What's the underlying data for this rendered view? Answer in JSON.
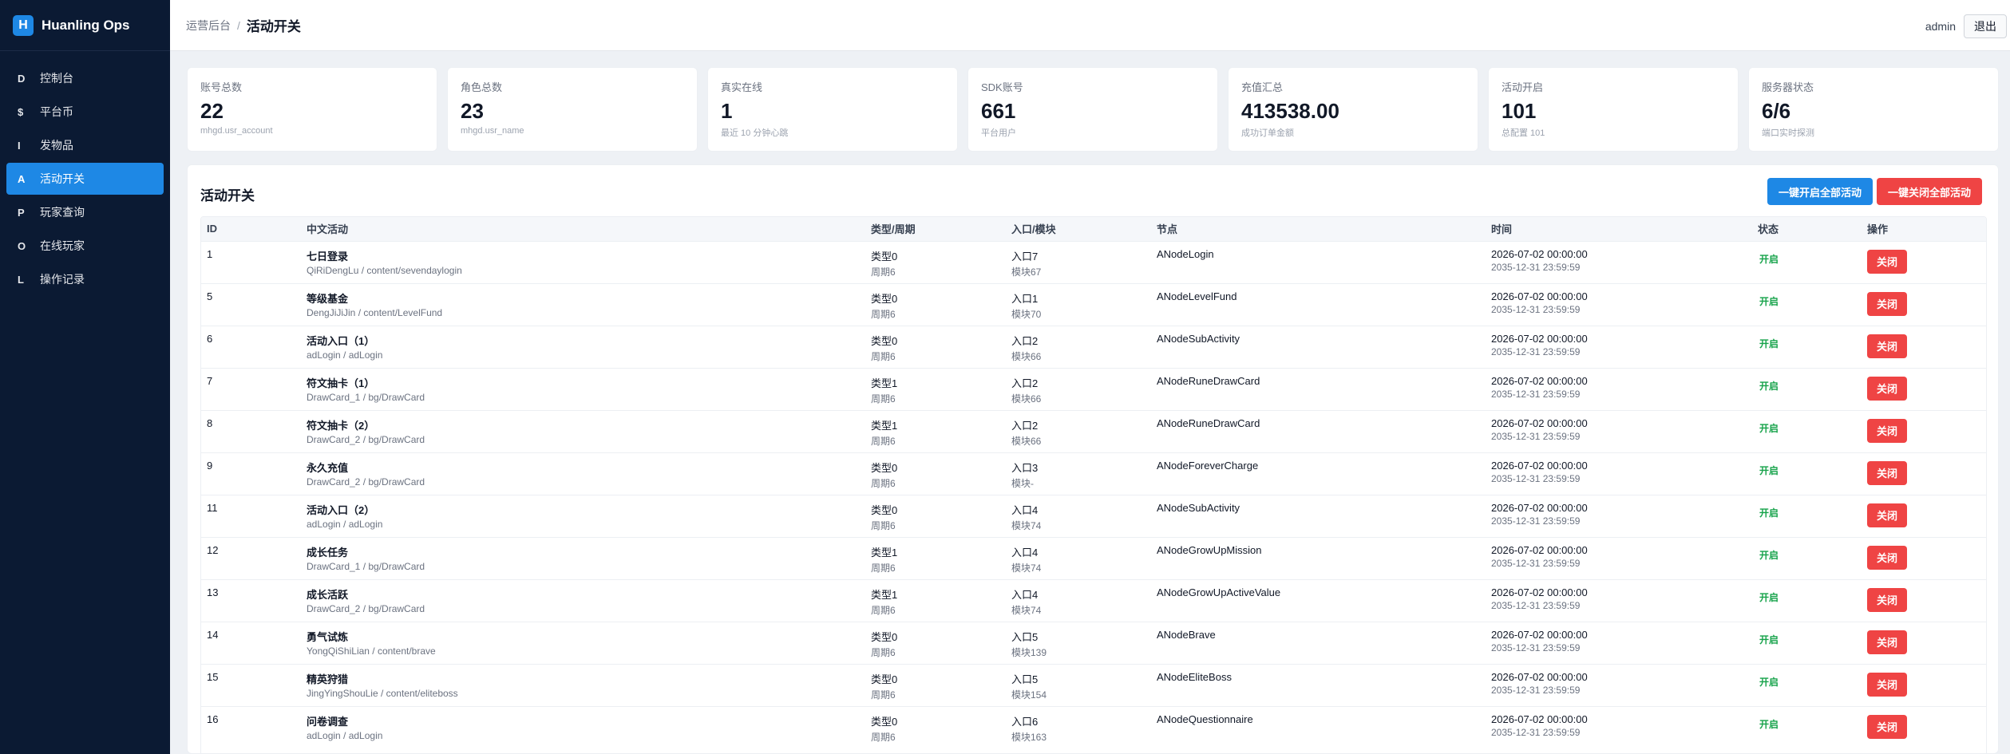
{
  "brand": {
    "logo": "H",
    "name": "Huanling Ops"
  },
  "sidebar": {
    "items": [
      {
        "letter": "D",
        "label": "控制台",
        "active": false
      },
      {
        "letter": "$",
        "label": "平台币",
        "active": false
      },
      {
        "letter": "I",
        "label": "发物品",
        "active": false
      },
      {
        "letter": "A",
        "label": "活动开关",
        "active": true
      },
      {
        "letter": "P",
        "label": "玩家查询",
        "active": false
      },
      {
        "letter": "O",
        "label": "在线玩家",
        "active": false
      },
      {
        "letter": "L",
        "label": "操作记录",
        "active": false
      }
    ]
  },
  "header": {
    "breadcrumb_parent": "运营后台",
    "breadcrumb_sep": "/",
    "title": "活动开关",
    "user": "admin",
    "logout": "退出"
  },
  "stats": [
    {
      "label": "账号总数",
      "value": "22",
      "sub": "mhgd.usr_account"
    },
    {
      "label": "角色总数",
      "value": "23",
      "sub": "mhgd.usr_name"
    },
    {
      "label": "真实在线",
      "value": "1",
      "sub": "最近 10 分钟心跳"
    },
    {
      "label": "SDK账号",
      "value": "661",
      "sub": "平台用户"
    },
    {
      "label": "充值汇总",
      "value": "413538.00",
      "sub": "成功订单金额"
    },
    {
      "label": "活动开启",
      "value": "101",
      "sub": "总配置 101"
    },
    {
      "label": "服务器状态",
      "value": "6/6",
      "sub": "端口实时探测"
    }
  ],
  "panel": {
    "title": "活动开关",
    "open_all": "一键开启全部活动",
    "close_all": "一键关闭全部活动"
  },
  "table": {
    "headers": [
      "ID",
      "中文活动",
      "类型/周期",
      "入口/模块",
      "节点",
      "时间",
      "状态",
      "操作"
    ],
    "rows": [
      {
        "id": "1",
        "name": "七日登录",
        "path": "QiRiDengLu / content/sevendaylogin",
        "type": "类型0",
        "cycle": "周期6",
        "entry": "入口7",
        "module": "模块67",
        "node": "ANodeLogin",
        "start": "2026-07-02 00:00:00",
        "end": "2035-12-31 23:59:59",
        "status": "开启",
        "action": "关闭"
      },
      {
        "id": "5",
        "name": "等级基金",
        "path": "DengJiJiJin / content/LevelFund",
        "type": "类型0",
        "cycle": "周期6",
        "entry": "入口1",
        "module": "模块70",
        "node": "ANodeLevelFund",
        "start": "2026-07-02 00:00:00",
        "end": "2035-12-31 23:59:59",
        "status": "开启",
        "action": "关闭"
      },
      {
        "id": "6",
        "name": "活动入口（1）",
        "path": "adLogin / adLogin",
        "type": "类型0",
        "cycle": "周期6",
        "entry": "入口2",
        "module": "模块66",
        "node": "ANodeSubActivity",
        "start": "2026-07-02 00:00:00",
        "end": "2035-12-31 23:59:59",
        "status": "开启",
        "action": "关闭"
      },
      {
        "id": "7",
        "name": "符文抽卡（1）",
        "path": "DrawCard_1 / bg/DrawCard",
        "type": "类型1",
        "cycle": "周期6",
        "entry": "入口2",
        "module": "模块66",
        "node": "ANodeRuneDrawCard",
        "start": "2026-07-02 00:00:00",
        "end": "2035-12-31 23:59:59",
        "status": "开启",
        "action": "关闭"
      },
      {
        "id": "8",
        "name": "符文抽卡（2）",
        "path": "DrawCard_2 / bg/DrawCard",
        "type": "类型1",
        "cycle": "周期6",
        "entry": "入口2",
        "module": "模块66",
        "node": "ANodeRuneDrawCard",
        "start": "2026-07-02 00:00:00",
        "end": "2035-12-31 23:59:59",
        "status": "开启",
        "action": "关闭"
      },
      {
        "id": "9",
        "name": "永久充值",
        "path": "DrawCard_2 / bg/DrawCard",
        "type": "类型0",
        "cycle": "周期6",
        "entry": "入口3",
        "module": "模块-",
        "node": "ANodeForeverCharge",
        "start": "2026-07-02 00:00:00",
        "end": "2035-12-31 23:59:59",
        "status": "开启",
        "action": "关闭"
      },
      {
        "id": "11",
        "name": "活动入口（2）",
        "path": "adLogin / adLogin",
        "type": "类型0",
        "cycle": "周期6",
        "entry": "入口4",
        "module": "模块74",
        "node": "ANodeSubActivity",
        "start": "2026-07-02 00:00:00",
        "end": "2035-12-31 23:59:59",
        "status": "开启",
        "action": "关闭"
      },
      {
        "id": "12",
        "name": "成长任务",
        "path": "DrawCard_1 / bg/DrawCard",
        "type": "类型1",
        "cycle": "周期6",
        "entry": "入口4",
        "module": "模块74",
        "node": "ANodeGrowUpMission",
        "start": "2026-07-02 00:00:00",
        "end": "2035-12-31 23:59:59",
        "status": "开启",
        "action": "关闭"
      },
      {
        "id": "13",
        "name": "成长活跃",
        "path": "DrawCard_2 / bg/DrawCard",
        "type": "类型1",
        "cycle": "周期6",
        "entry": "入口4",
        "module": "模块74",
        "node": "ANodeGrowUpActiveValue",
        "start": "2026-07-02 00:00:00",
        "end": "2035-12-31 23:59:59",
        "status": "开启",
        "action": "关闭"
      },
      {
        "id": "14",
        "name": "勇气试炼",
        "path": "YongQiShiLian / content/brave",
        "type": "类型0",
        "cycle": "周期6",
        "entry": "入口5",
        "module": "模块139",
        "node": "ANodeBrave",
        "start": "2026-07-02 00:00:00",
        "end": "2035-12-31 23:59:59",
        "status": "开启",
        "action": "关闭"
      },
      {
        "id": "15",
        "name": "精英狩猎",
        "path": "JingYingShouLie / content/eliteboss",
        "type": "类型0",
        "cycle": "周期6",
        "entry": "入口5",
        "module": "模块154",
        "node": "ANodeEliteBoss",
        "start": "2026-07-02 00:00:00",
        "end": "2035-12-31 23:59:59",
        "status": "开启",
        "action": "关闭"
      },
      {
        "id": "16",
        "name": "问卷调查",
        "path": "adLogin / adLogin",
        "type": "类型0",
        "cycle": "周期6",
        "entry": "入口6",
        "module": "模块163",
        "node": "ANodeQuestionnaire",
        "start": "2026-07-02 00:00:00",
        "end": "2035-12-31 23:59:59",
        "status": "开启",
        "action": "关闭"
      }
    ]
  }
}
